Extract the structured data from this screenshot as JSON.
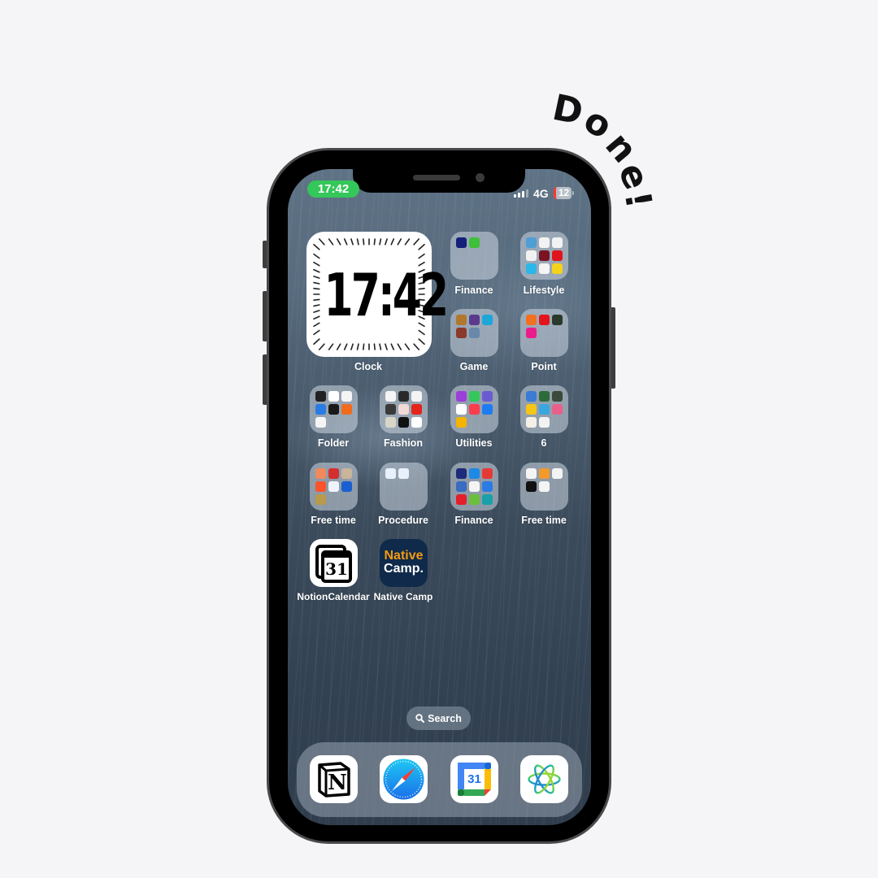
{
  "overlay": {
    "done_text": [
      "D",
      "o",
      "n",
      "e",
      "!"
    ]
  },
  "status_bar": {
    "time": "17:42",
    "network": "4G",
    "battery": "12",
    "colors": {
      "time_pill": "#34c759",
      "battery_low": "#ff3b30"
    }
  },
  "widget": {
    "time": "17:42",
    "label": "Clock"
  },
  "folders": [
    {
      "label": "Finance"
    },
    {
      "label": "Lifestyle"
    },
    {
      "label": "Game"
    },
    {
      "label": "Point"
    },
    {
      "label": "Folder"
    },
    {
      "label": "Fashion"
    },
    {
      "label": "Utilities"
    },
    {
      "label": "6"
    },
    {
      "label": "Free time"
    },
    {
      "label": "Procedure"
    },
    {
      "label": "Finance"
    },
    {
      "label": "Free time"
    }
  ],
  "apps": [
    {
      "label": "NotionCalendar",
      "icon_text": "31",
      "icon": "notion-calendar-icon"
    },
    {
      "label": "Native Camp",
      "icon_text_1": "Native",
      "icon_text_2": "Camp.",
      "icon": "native-camp-icon"
    }
  ],
  "search": {
    "label": "Search"
  },
  "dock": [
    {
      "name": "Notion",
      "icon": "notion-icon",
      "glyph": "N"
    },
    {
      "name": "Safari",
      "icon": "safari-icon"
    },
    {
      "name": "Google Calendar",
      "icon": "google-calendar-icon",
      "glyph": "31"
    },
    {
      "name": "Perplexity-like AI app",
      "icon": "ai-app-icon"
    }
  ]
}
